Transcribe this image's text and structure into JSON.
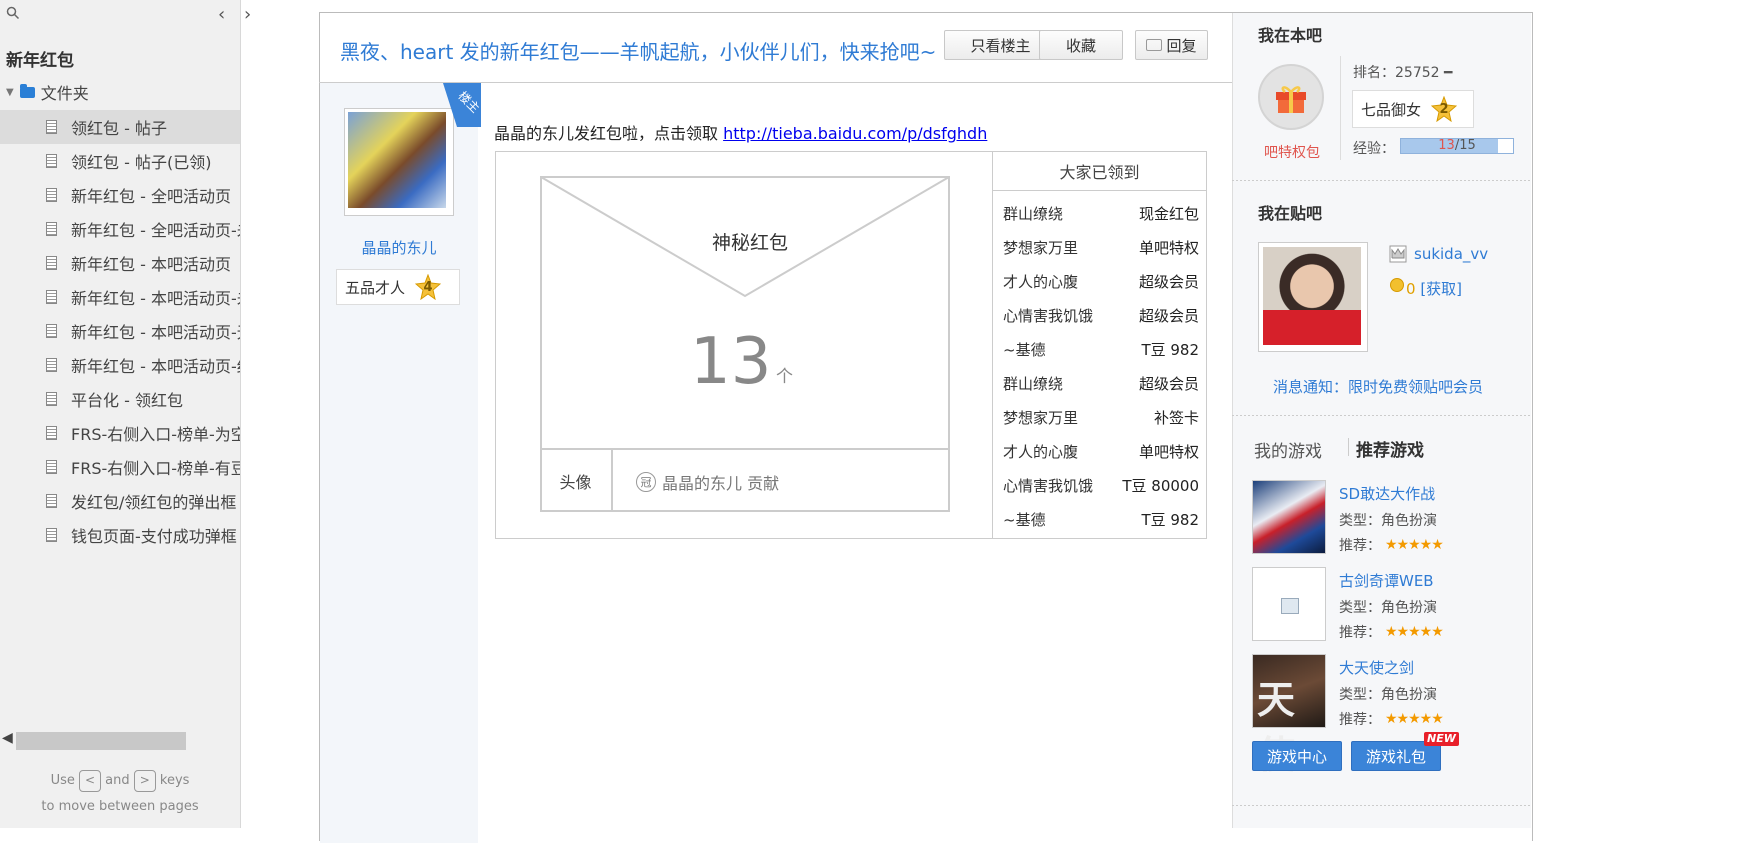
{
  "sidebar": {
    "project_title": "新年红包",
    "folder_label": "文件夹",
    "pages": [
      "领红包 - 帖子",
      "领红包 - 帖子(已领)",
      "新年红包 - 全吧活动页",
      "新年红包 - 全吧活动页-未领",
      "新年红包 - 本吧活动页",
      "新年红包 - 本吧活动页-未领",
      "新年红包 - 本吧活动页-无人",
      "新年红包 - 本吧活动页-红包",
      "平台化 - 领红包",
      "FRS-右侧入口-榜单-为空",
      "FRS-右侧入口-榜单-有豆",
      "发红包/领红包的弹出框",
      "钱包页面-支付成功弹框"
    ],
    "hint_use": "Use",
    "hint_and": "and",
    "hint_keys": "keys",
    "hint_line2": "to move between pages",
    "key_prev": "<",
    "key_next": ">"
  },
  "post": {
    "title": "黑夜、heart 发的新年红包——羊帆起航，小伙伴儿们，快来抢吧~",
    "btn_host_only": "只看楼主",
    "btn_favorite": "收藏",
    "btn_reply": "回复",
    "host_ribbon": "楼主",
    "author_name": "晶晶的东儿",
    "author_rank": "五品才人",
    "author_level": "4",
    "text": "晶晶的东儿发红包啦，点击领取 ",
    "link": "http://tieba.baidu.com/p/dsfghdh"
  },
  "redpacket": {
    "label": "神秘红包",
    "count": "13",
    "unit": "个",
    "avatar_label": "头像",
    "contributor": "晶晶的东儿 贡献",
    "crown_char": "冠"
  },
  "received": {
    "header": "大家已领到",
    "rows": [
      {
        "user": "群山缭绕",
        "prize": "现金红包"
      },
      {
        "user": "梦想家万里",
        "prize": "单吧特权"
      },
      {
        "user": "才人的心腹",
        "prize": "超级会员"
      },
      {
        "user": "心情害我饥饿",
        "prize": "超级会员"
      },
      {
        "user": "~基德",
        "prize": "T豆 982"
      },
      {
        "user": "群山缭绕",
        "prize": "超级会员"
      },
      {
        "user": "梦想家万里",
        "prize": "补签卡"
      },
      {
        "user": "才人的心腹",
        "prize": "单吧特权"
      },
      {
        "user": "心情害我饥饿",
        "prize": "T豆 80000"
      },
      {
        "user": "~基德",
        "prize": "T豆 982"
      }
    ]
  },
  "right": {
    "in_bar_title": "我在本吧",
    "privilege_label": "吧特权包",
    "rank_text": "排名：25752 ━",
    "rank_title": "七品御女",
    "rank_level": "2",
    "exp_label": "经验：",
    "exp_current": "13",
    "exp_total": "/15",
    "exp_fraction": 0.87,
    "in_tieba_title": "我在贴吧",
    "username": "sukida_vv",
    "coin_count": "0",
    "coin_action": "[获取]",
    "notice": "消息通知：限时免费领贴吧会员",
    "tab_my_games": "我的游戏",
    "tab_rec_games": "推荐游戏",
    "games": [
      {
        "name": "SD敢达大作战",
        "type": "类型：角色扮演",
        "rec": "推荐：",
        "stars": "★★★★★"
      },
      {
        "name": "古剑奇谭WEB",
        "type": "类型：角色扮演",
        "rec": "推荐：",
        "stars": "★★★★★"
      },
      {
        "name": "大天使之剑",
        "type": "类型：角色扮演",
        "rec": "推荐：",
        "stars": "★★★★★"
      }
    ],
    "game3_thumb_text": "天使",
    "btn_game_center": "游戏中心",
    "btn_game_gift": "游戏礼包",
    "new_badge": "NEW"
  },
  "colors": {
    "accent_blue": "#2f7bd4",
    "red": "#e0554e",
    "star_gold": "#f39a00"
  }
}
